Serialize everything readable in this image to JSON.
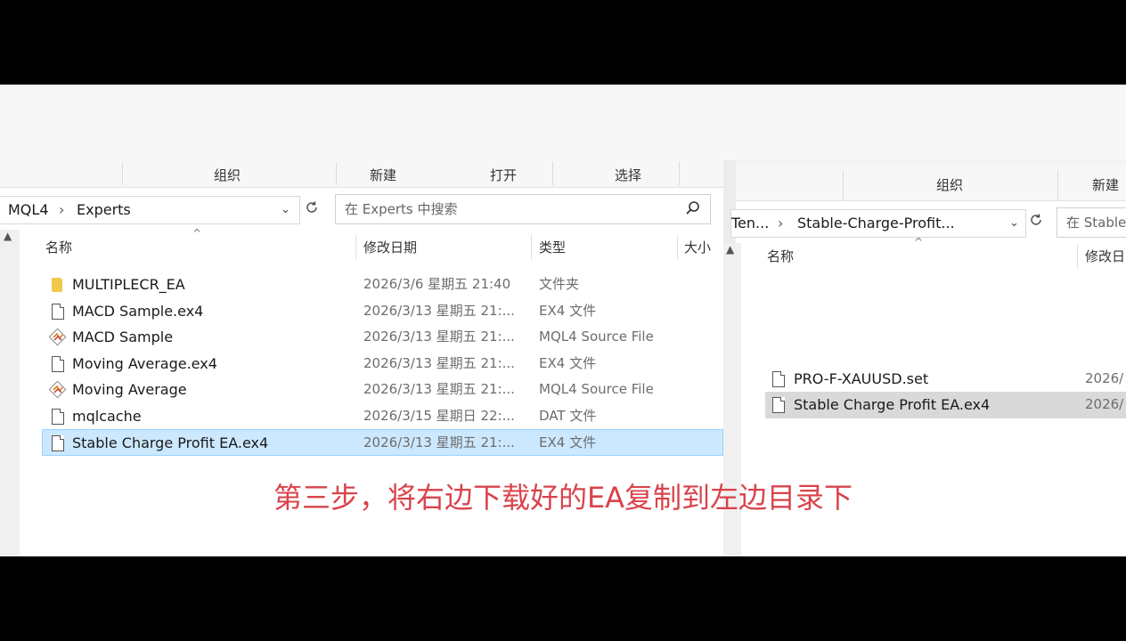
{
  "left_window": {
    "ribbon": [
      "组织",
      "新建",
      "打开",
      "选择"
    ],
    "breadcrumb": [
      "MQL4",
      "Experts"
    ],
    "search_placeholder": "在 Experts 中搜索",
    "columns": [
      "名称",
      "修改日期",
      "类型",
      "大小"
    ],
    "files": [
      {
        "icon": "folder-icon",
        "name": "MULTIPLECR_EA",
        "date": "2026/3/6 星期五 21:40",
        "type": "文件夹"
      },
      {
        "icon": "file-icon",
        "name": "MACD Sample.ex4",
        "date": "2026/3/13 星期五 21:...",
        "type": "EX4 文件"
      },
      {
        "icon": "mql-source-icon",
        "name": "MACD Sample",
        "date": "2026/3/13 星期五 21:...",
        "type": "MQL4 Source File"
      },
      {
        "icon": "file-icon",
        "name": "Moving Average.ex4",
        "date": "2026/3/13 星期五 21:...",
        "type": "EX4 文件"
      },
      {
        "icon": "mql-source-icon",
        "name": "Moving Average",
        "date": "2026/3/13 星期五 21:...",
        "type": "MQL4 Source File"
      },
      {
        "icon": "file-icon",
        "name": "mqlcache",
        "date": "2026/3/15 星期日 22:...",
        "type": "DAT 文件"
      },
      {
        "icon": "file-icon",
        "name": "Stable Charge Profit EA.ex4",
        "date": "2026/3/13 星期五 21:...",
        "type": "EX4 文件",
        "selected": true
      }
    ]
  },
  "right_window": {
    "ribbon": [
      "组织",
      "新建"
    ],
    "breadcrumb": [
      "Ten...",
      "Stable-Charge-Profit..."
    ],
    "search_placeholder": "在 Stable",
    "columns": [
      "名称",
      "修改日"
    ],
    "files": [
      {
        "icon": "file-icon",
        "name": "PRO-F-XAUUSD.set",
        "date": "2026/"
      },
      {
        "icon": "file-icon",
        "name": "Stable Charge Profit EA.ex4",
        "date": "2026/",
        "selected": true
      }
    ]
  },
  "caption": "第三步，将右边下载好的EA复制到左边目录下",
  "colors": {
    "caption": "#d9434b",
    "selection": "#cce8ff",
    "selection_grey": "#d9d9d9",
    "folder": "#f2c84b"
  }
}
